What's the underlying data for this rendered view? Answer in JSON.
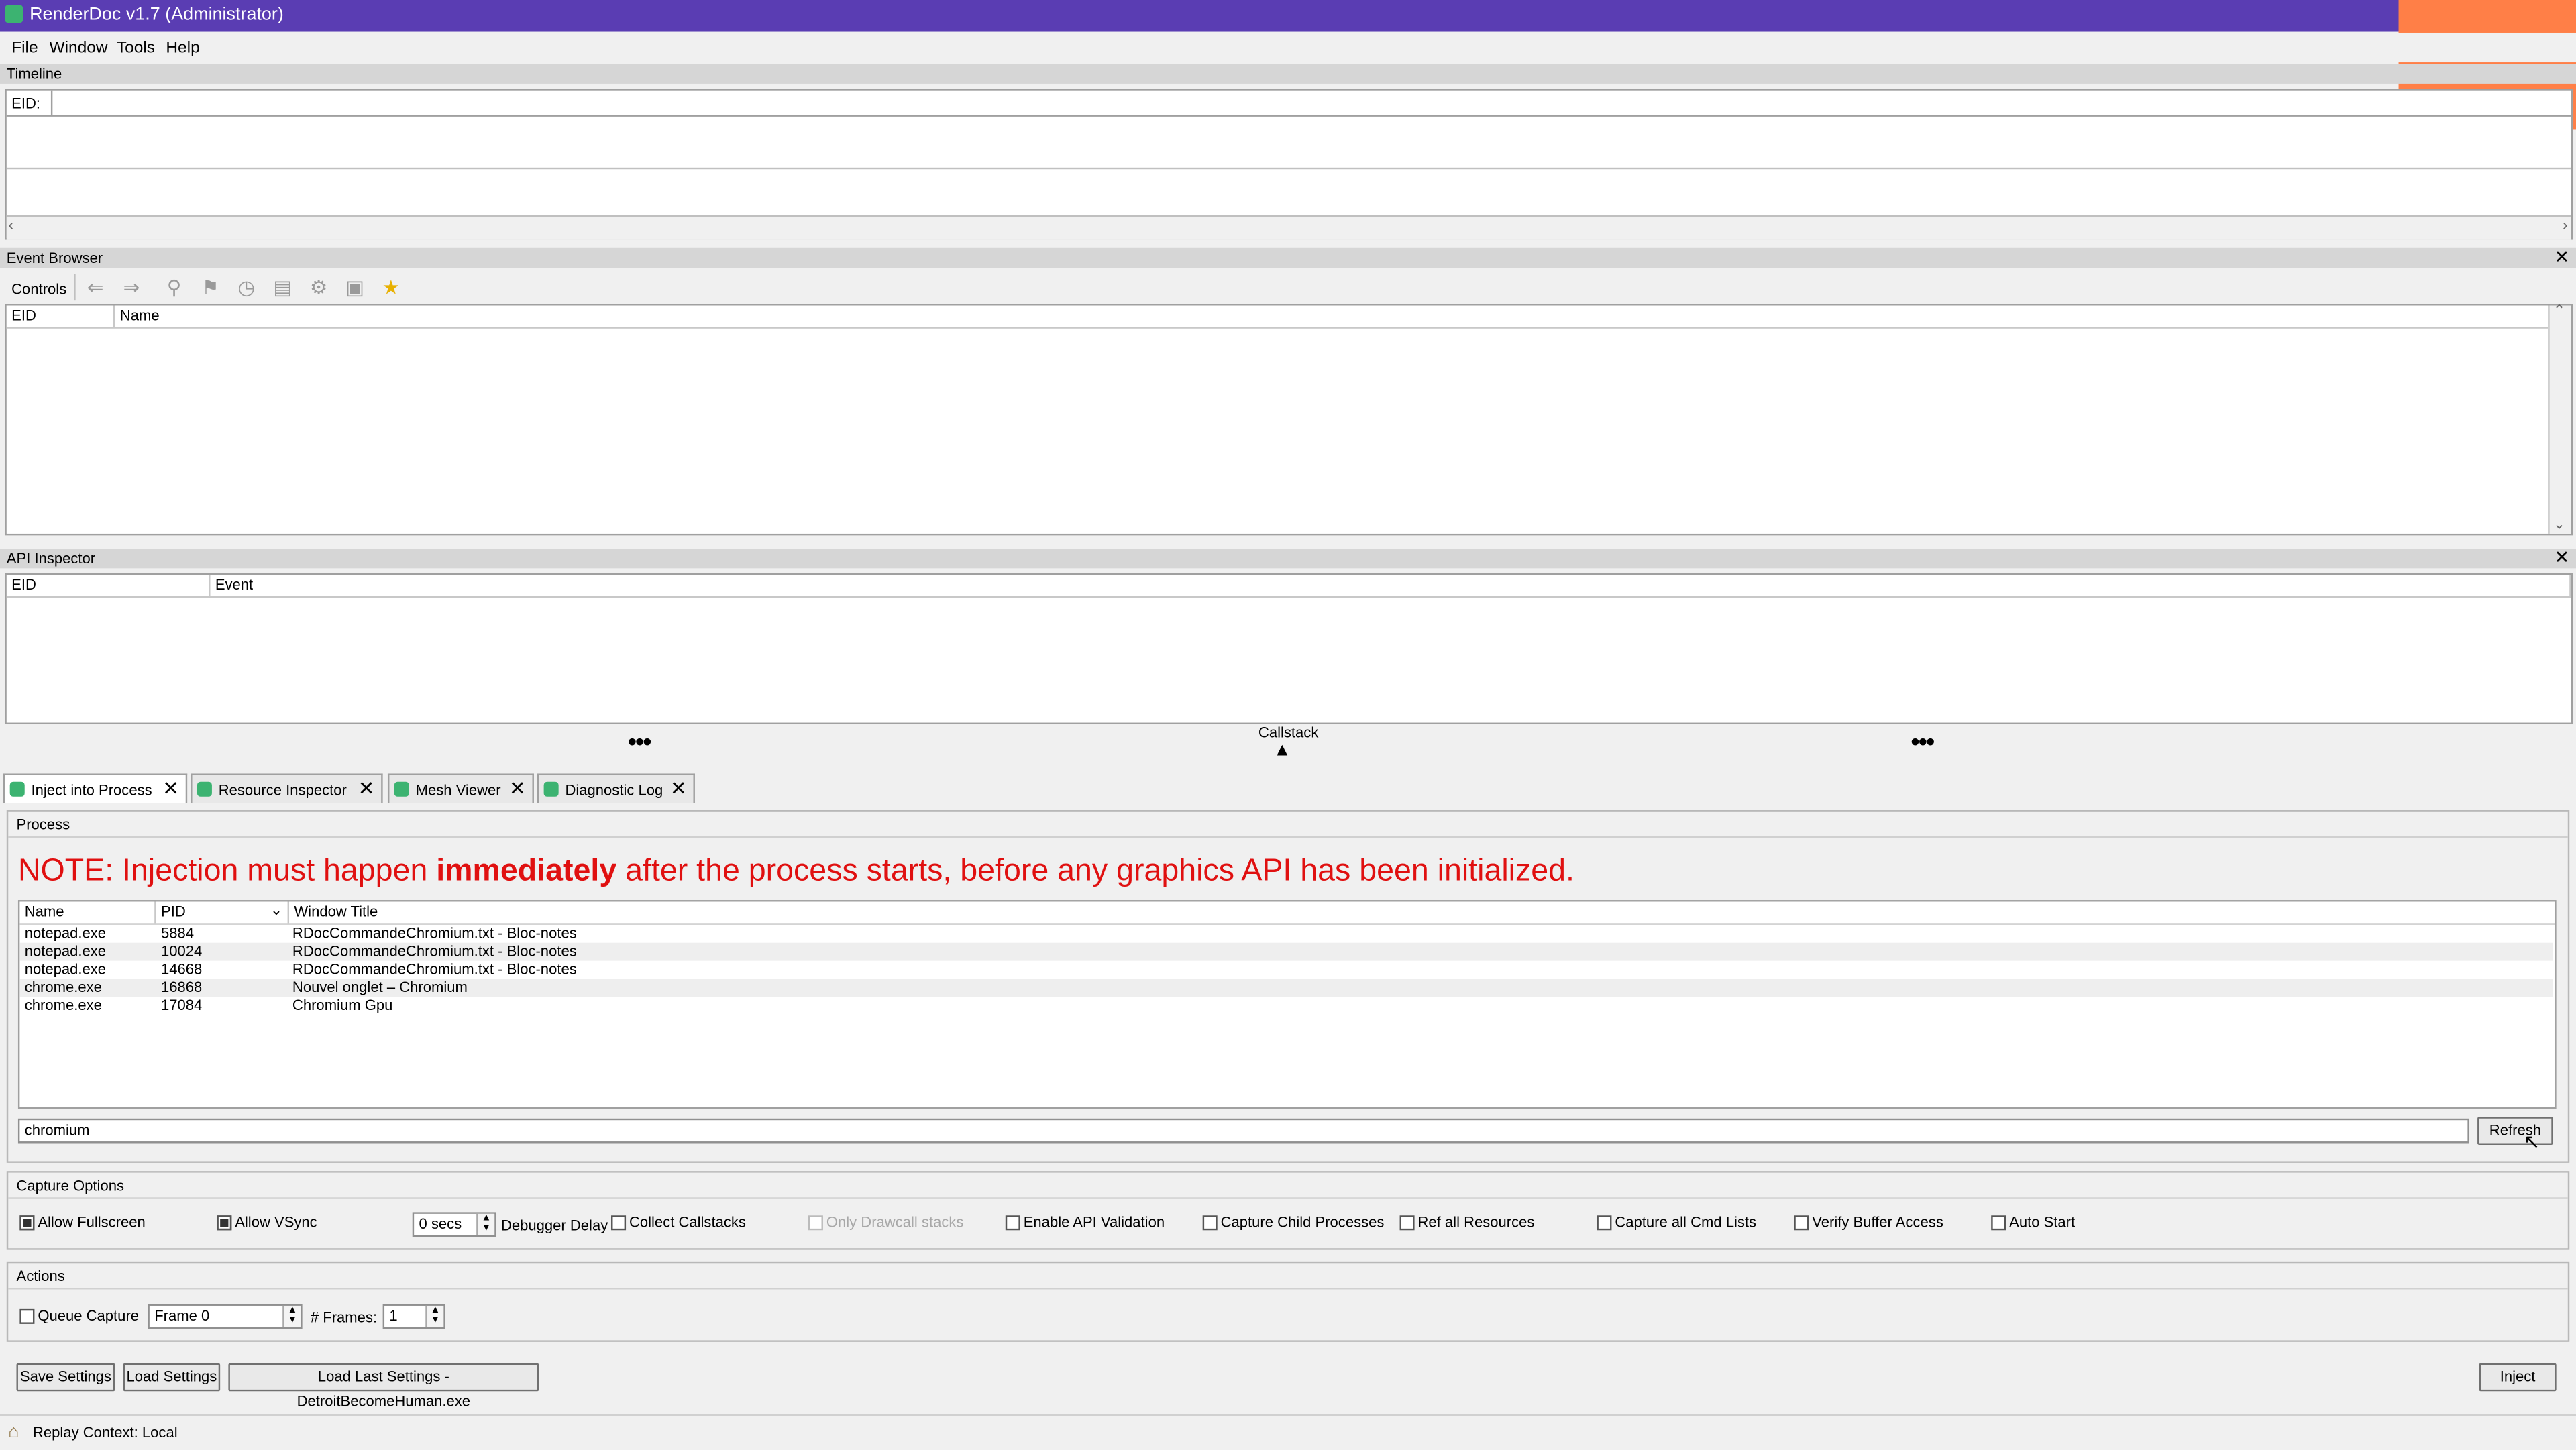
{
  "window": {
    "title": "RenderDoc v1.7 (Administrator)"
  },
  "menu": [
    "File",
    "Window",
    "Tools",
    "Help"
  ],
  "timeline": {
    "title": "Timeline",
    "eid_label": "EID:"
  },
  "event_browser": {
    "title": "Event Browser",
    "controls_label": "Controls",
    "columns": [
      "EID",
      "Name"
    ]
  },
  "api_inspector": {
    "title": "API Inspector",
    "columns": [
      "EID",
      "Event"
    ],
    "callstack_label": "Callstack"
  },
  "tabs": [
    {
      "label": "Inject into Process",
      "active": true
    },
    {
      "label": "Resource Inspector",
      "active": false
    },
    {
      "label": "Mesh Viewer",
      "active": false
    },
    {
      "label": "Diagnostic Log",
      "active": false
    }
  ],
  "process": {
    "group_title": "Process",
    "note_before": "NOTE: Injection must happen ",
    "note_bold": "immediately",
    "note_after": " after the process starts, before any graphics API has been initialized.",
    "columns": [
      "Name",
      "PID",
      "Window Title"
    ],
    "rows": [
      {
        "name": "notepad.exe",
        "pid": "5884",
        "title": "RDocCommandeChromium.txt - Bloc-notes"
      },
      {
        "name": "notepad.exe",
        "pid": "10024",
        "title": "RDocCommandeChromium.txt - Bloc-notes"
      },
      {
        "name": "notepad.exe",
        "pid": "14668",
        "title": "RDocCommandeChromium.txt - Bloc-notes"
      },
      {
        "name": "chrome.exe",
        "pid": "16868",
        "title": "Nouvel onglet – Chromium"
      },
      {
        "name": "chrome.exe",
        "pid": "17084",
        "title": "Chromium Gpu"
      }
    ],
    "filter_value": "chromium",
    "refresh_label": "Refresh"
  },
  "capture_options": {
    "group_title": "Capture Options",
    "allow_fullscreen": {
      "label": "Allow Fullscreen",
      "checked": true
    },
    "allow_vsync": {
      "label": "Allow VSync",
      "checked": true
    },
    "debugger_delay_value": "0 secs",
    "debugger_delay_label": "Debugger Delay",
    "collect_callstacks": {
      "label": "Collect Callstacks",
      "checked": false
    },
    "only_drawcall_stacks": {
      "label": "Only Drawcall stacks",
      "checked": false
    },
    "enable_api_validation": {
      "label": "Enable API Validation",
      "checked": false
    },
    "capture_child_processes": {
      "label": "Capture Child Processes",
      "checked": false
    },
    "ref_all_resources": {
      "label": "Ref all Resources",
      "checked": false
    },
    "capture_all_cmd_lists": {
      "label": "Capture all Cmd Lists",
      "checked": false
    },
    "verify_buffer_access": {
      "label": "Verify Buffer Access",
      "checked": false
    },
    "auto_start": {
      "label": "Auto Start",
      "checked": false
    }
  },
  "actions": {
    "group_title": "Actions",
    "queue_capture": {
      "label": "Queue Capture",
      "checked": false
    },
    "frame_value": "Frame 0",
    "frames_label": "# Frames:",
    "frames_value": "1"
  },
  "bottom": {
    "save_settings": "Save Settings",
    "load_settings": "Load Settings",
    "load_last_settings": "Load Last Settings - DetroitBecomeHuman.exe",
    "inject": "Inject"
  },
  "status": {
    "text": "Replay Context: Local"
  }
}
